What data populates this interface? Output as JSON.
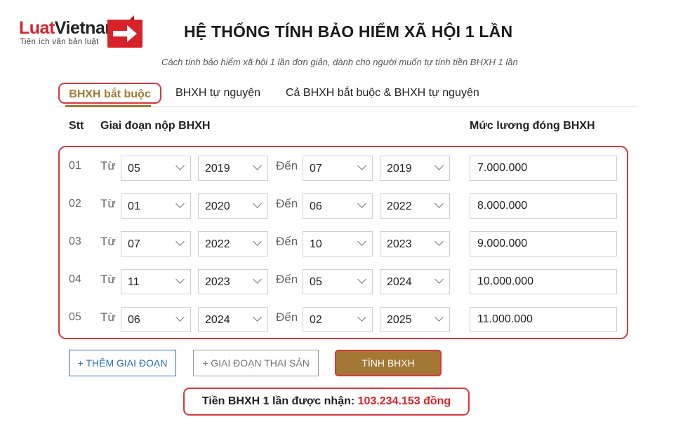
{
  "brand": {
    "name_red": "Luat",
    "name_dark": "Vietnam",
    "tagline": "Tiện ích văn bản luật",
    "accent": "#d8222a"
  },
  "title": "HỆ THỐNG TÍNH BẢO HIỂM XÃ HỘI 1 LẦN",
  "subtitle": "Cách tính bảo hiểm xã hội 1 lần đơn giản, dành cho người muốn tự tính tiền BHXH 1 lần",
  "tabs": [
    {
      "label": "BHXH bắt buộc",
      "active": true
    },
    {
      "label": "BHXH tự nguyện",
      "active": false
    },
    {
      "label": "Cả BHXH bắt buộc & BHXH tự nguyện",
      "active": false
    }
  ],
  "table": {
    "headers": {
      "stt": "Stt",
      "period": "Giai đoạn nộp BHXH",
      "salary": "Mức lương đóng BHXH"
    },
    "from_label": "Từ",
    "to_label": "Đến",
    "rows": [
      {
        "stt": "01",
        "from_month": "05",
        "from_year": "2019",
        "to_month": "07",
        "to_year": "2019",
        "salary": "7.000.000"
      },
      {
        "stt": "02",
        "from_month": "01",
        "from_year": "2020",
        "to_month": "06",
        "to_year": "2022",
        "salary": "8.000.000"
      },
      {
        "stt": "03",
        "from_month": "07",
        "from_year": "2022",
        "to_month": "10",
        "to_year": "2023",
        "salary": "9.000.000"
      },
      {
        "stt": "04",
        "from_month": "11",
        "from_year": "2023",
        "to_month": "05",
        "to_year": "2024",
        "salary": "10.000.000"
      },
      {
        "stt": "05",
        "from_month": "06",
        "from_year": "2024",
        "to_month": "02",
        "to_year": "2025",
        "salary": "11.000.000"
      }
    ]
  },
  "buttons": {
    "add_period": "+ THÊM GIAI ĐOẠN",
    "maternity_period": "+ GIAI ĐOẠN THAI SẢN",
    "calculate": "TÍNH BHXH"
  },
  "result": {
    "label": "Tiền BHXH 1 lần được nhận:",
    "amount": "103.234.153 đồng"
  },
  "colors": {
    "gold": "#a27834",
    "highlight_red": "#d9363e",
    "link_blue": "#2b6cc4"
  }
}
